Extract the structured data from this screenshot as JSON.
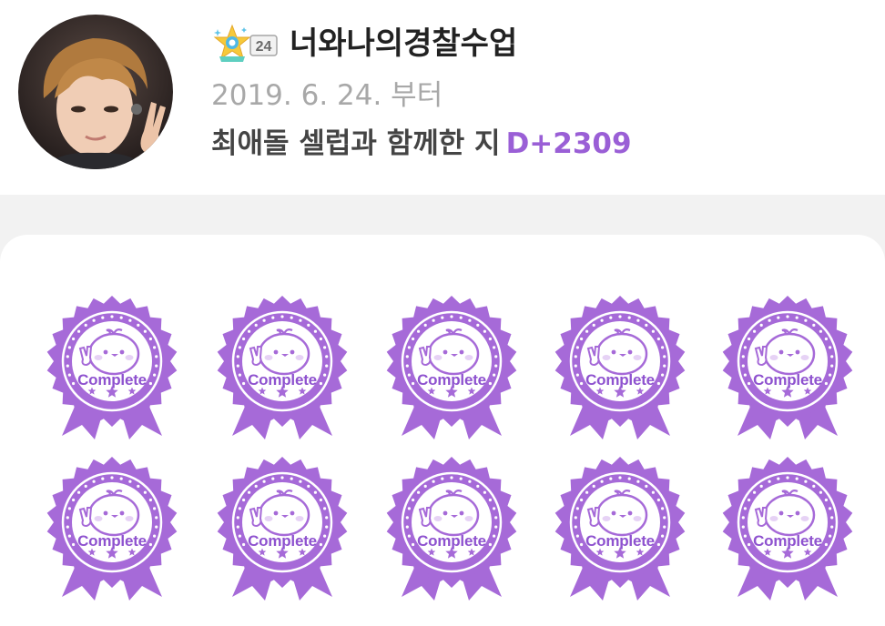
{
  "profile": {
    "level": "24",
    "nickname": "너와나의경찰수업",
    "since_date": "2019. 6. 24. 부터",
    "dday_prefix": "최애돌 셀럽과 함께한 지",
    "dday_value": "D+2309"
  },
  "colors": {
    "accent": "#9a5fd6",
    "badge_fill": "#a66ad8",
    "muted_text": "#a8a8a8"
  },
  "badges": [
    {
      "label": "Complete",
      "icon": "chick-peace-icon"
    },
    {
      "label": "Complete",
      "icon": "chick-peace-icon"
    },
    {
      "label": "Complete",
      "icon": "chick-peace-icon"
    },
    {
      "label": "Complete",
      "icon": "chick-peace-icon"
    },
    {
      "label": "Complete",
      "icon": "chick-peace-icon"
    },
    {
      "label": "Complete",
      "icon": "chick-peace-icon"
    },
    {
      "label": "Complete",
      "icon": "chick-peace-icon"
    },
    {
      "label": "Complete",
      "icon": "chick-peace-icon"
    },
    {
      "label": "Complete",
      "icon": "chick-peace-icon"
    },
    {
      "label": "Complete",
      "icon": "chick-peace-icon"
    }
  ]
}
